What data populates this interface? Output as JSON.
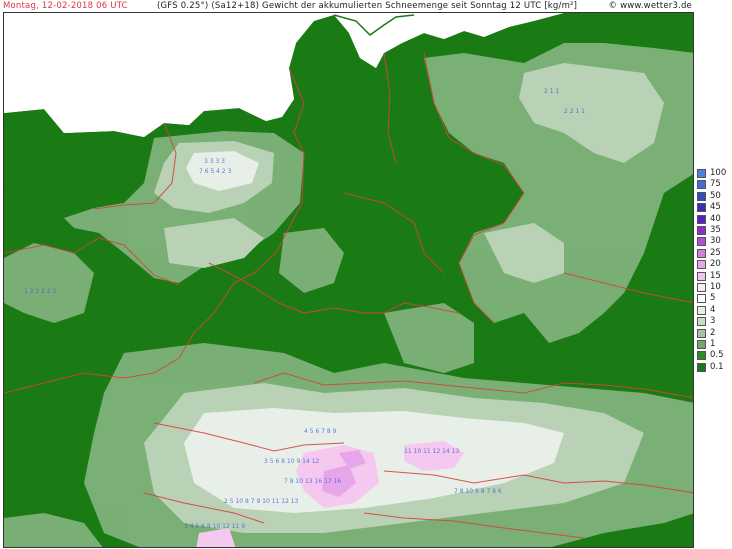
{
  "header": {
    "date_label": "Montag, 12-02-2018  06 UTC",
    "title": "(GFS 0.25°) (Sa12+18)    Gewicht der akkumulierten Schneemenge seit Sonntag 12 UTC [kg/m²]",
    "credit": "© www.wetter3.de"
  },
  "colors": {
    "snow_low": "#2f8a2a",
    "snow_mid": "#7fb27a",
    "snow_light": "#b9d2b6",
    "snow_high": "#e8efe8",
    "snow_peak": "#f4c8ef",
    "borders": "#d94040",
    "land_nosnow": "#1a7a14",
    "sea": "#ffffff"
  },
  "legend": {
    "levels": [
      {
        "label": "100",
        "color": "#4d7fe0"
      },
      {
        "label": "75",
        "color": "#3f6ed4"
      },
      {
        "label": "50",
        "color": "#2f4fc4"
      },
      {
        "label": "45",
        "color": "#3a2fb8"
      },
      {
        "label": "40",
        "color": "#5a1fc0"
      },
      {
        "label": "35",
        "color": "#8a2ed0"
      },
      {
        "label": "30",
        "color": "#b04ed8"
      },
      {
        "label": "25",
        "color": "#d27ee2"
      },
      {
        "label": "20",
        "color": "#e8a6ea"
      },
      {
        "label": "15",
        "color": "#f3c8f0"
      },
      {
        "label": "10",
        "color": "#fbe8f8"
      },
      {
        "label": "5",
        "color": "#ffffff"
      },
      {
        "label": "4",
        "color": "#e6ece6"
      },
      {
        "label": "3",
        "color": "#c8dcc6"
      },
      {
        "label": "2",
        "color": "#a3c4a0"
      },
      {
        "label": "1",
        "color": "#6fa86a"
      },
      {
        "label": "0.5",
        "color": "#2f8a2a"
      },
      {
        "label": "0.1",
        "color": "#1a7a14"
      }
    ]
  }
}
